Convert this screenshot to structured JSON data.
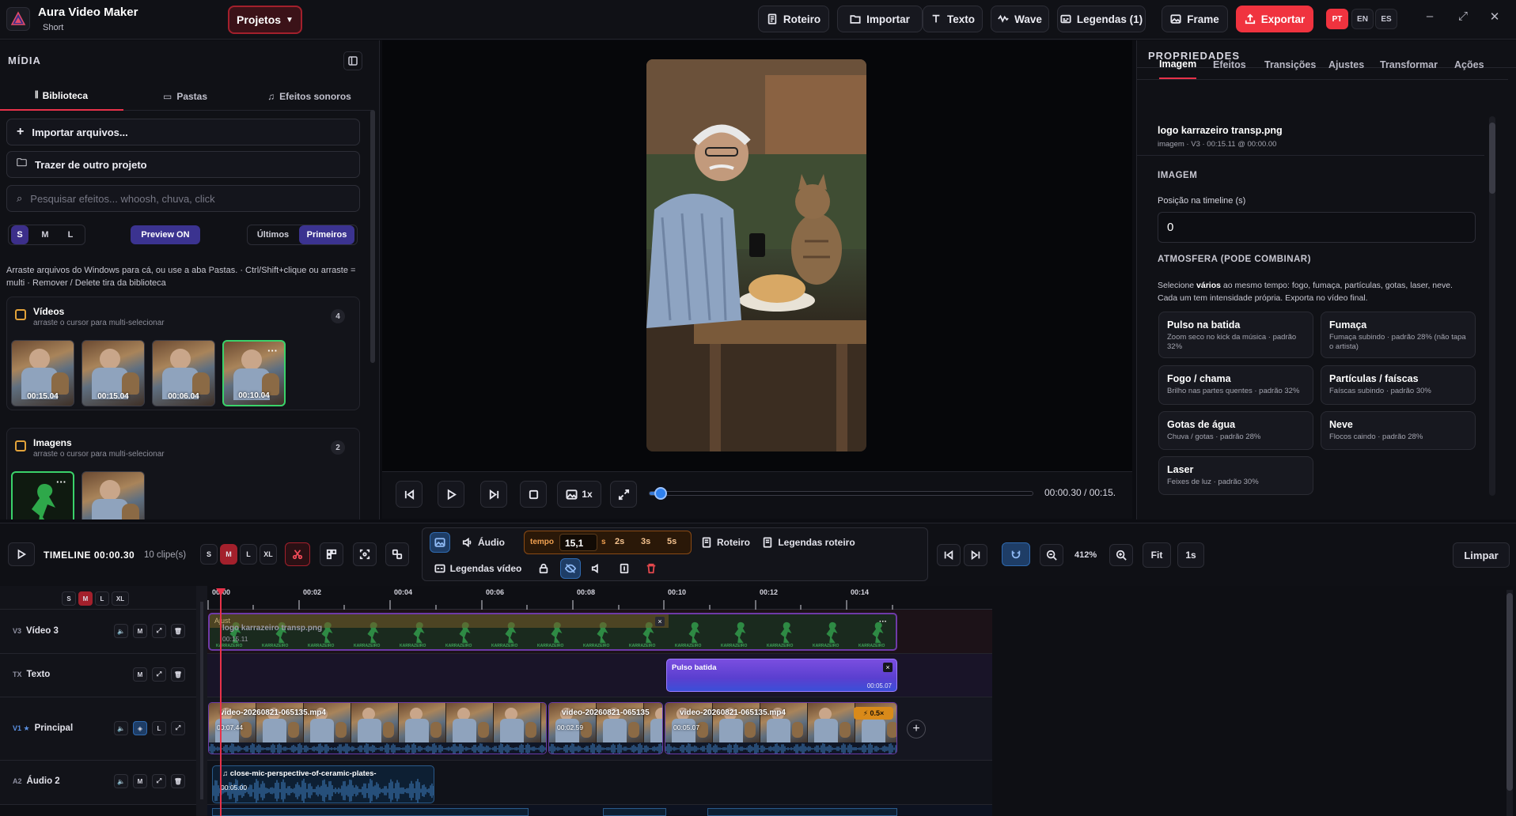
{
  "app": {
    "name": "Aura Video Maker",
    "subtitle": "Short"
  },
  "header": {
    "projects_label": "Projetos",
    "buttons": [
      "Roteiro",
      "Importar",
      "Texto",
      "Wave",
      "Legendas (1)",
      "Frame"
    ],
    "export_label": "Exportar",
    "languages": [
      "PT",
      "EN",
      "ES"
    ],
    "window": {
      "minimize": "–",
      "maximize": "⤢",
      "close": "✕"
    }
  },
  "media": {
    "title": "MÍDIA",
    "tabs": [
      "Biblioteca",
      "Pastas",
      "Efeitos sonoros"
    ],
    "import_label": "Importar arquivos...",
    "bring_label": "Trazer de outro projeto",
    "search_placeholder": "Pesquisar efeitos... whoosh, chuva, click",
    "sizes": [
      "S",
      "M",
      "L"
    ],
    "preview_label": "Preview ON",
    "order": [
      "Últimos",
      "Primeiros"
    ],
    "hint": "Arraste arquivos do Windows para cá, ou use a aba Pastas. · Ctrl/Shift+clique ou arraste = multi · Remover / Delete tira da biblioteca",
    "videos": {
      "title": "Vídeos",
      "sub": "arraste o cursor para multi-selecionar",
      "count": "4",
      "durations": [
        "00:15.04",
        "00:15.04",
        "00:06.04",
        "00:10.04"
      ]
    },
    "images": {
      "title": "Imagens",
      "sub": "arraste o cursor para multi-selecionar",
      "count": "2"
    },
    "more": "···"
  },
  "player": {
    "speed": "1x",
    "time": "00:00.30 / 00:15.",
    "progress": 0.02
  },
  "properties": {
    "title": "PROPRIEDADES",
    "tabs": [
      "Imagem",
      "Efeitos",
      "Transições",
      "Ajustes",
      "Transformar",
      "Ações"
    ],
    "item_name": "logo karrazeiro transp.png",
    "item_meta": "imagem · V3 · 00:15.11 @ 00:00.00",
    "section_image": "IMAGEM",
    "position_label": "Posição na timeline (s)",
    "position_value": "0",
    "section_atmos": "ATMOSFERA (PODE COMBINAR)",
    "atmos_desc_pre": "Selecione ",
    "atmos_desc_bold": "vários",
    "atmos_desc_post": " ao mesmo tempo: fogo, fumaça, partículas, gotas, laser, neve. Cada um tem intensidade própria. Exporta no vídeo final.",
    "effects": [
      {
        "name": "Pulso na batida",
        "desc": "Zoom seco no kick da música · padrão 32%"
      },
      {
        "name": "Fumaça",
        "desc": "Fumaça subindo · padrão 28% (não tapa o artista)"
      },
      {
        "name": "Fogo / chama",
        "desc": "Brilho nas partes quentes · padrão 32%"
      },
      {
        "name": "Partículas / faíscas",
        "desc": "Faíscas subindo · padrão 30%"
      },
      {
        "name": "Gotas de água",
        "desc": "Chuva / gotas · padrão 28%"
      },
      {
        "name": "Neve",
        "desc": "Flocos caindo · padrão 28%"
      },
      {
        "name": "Laser",
        "desc": "Feixes de luz · padrão 30%"
      }
    ]
  },
  "timeline": {
    "label": "TIMELINE",
    "time": "00:00.30",
    "clips": "10 clipe(s)",
    "sizes": [
      "S",
      "M",
      "L",
      "XL"
    ],
    "audio_label": "Áudio",
    "tempo_label": "tempo",
    "tempo_value": "15,1",
    "tempo_unit": "s",
    "tempo_presets": [
      "2s",
      "3s",
      "5s"
    ],
    "script_label": "Roteiro",
    "script_subs_label": "Legendas roteiro",
    "video_subs_label": "Legendas vídeo",
    "zoom": "412%",
    "fit": "Fit",
    "step": "1s",
    "clear": "Limpar",
    "ruler": [
      "00:00",
      "00:02",
      "00:04",
      "00:06",
      "00:08",
      "00:10",
      "00:12",
      "00:14"
    ],
    "tracks": [
      {
        "id": "V3",
        "name": "Vídeo 3"
      },
      {
        "id": "TX",
        "name": "Texto"
      },
      {
        "id": "V1 ★",
        "name": "Principal"
      },
      {
        "id": "A2",
        "name": "Áudio 2"
      }
    ],
    "clip_labels": {
      "logo": "logo karrazeiro transp.png",
      "logo_tag": "Ajust",
      "logo_time": "00:15.11",
      "pulse": "Pulso batida",
      "pulse_time": "00:05.07",
      "v1a": "video-20260821-065135.mp4",
      "v1a_time": "00:07.44",
      "v1b": "video-20260821-065135",
      "v1b_time": "00:02.59",
      "v1c": "video-20260821-065135.mp4",
      "v1c_time": "00:05.07",
      "speed_badge": "0.5×",
      "audio": "close-mic-perspective-of-ceramic-plates-",
      "audio_time": "00:05.00",
      "logo_text": "KARRAZEIRO"
    }
  }
}
